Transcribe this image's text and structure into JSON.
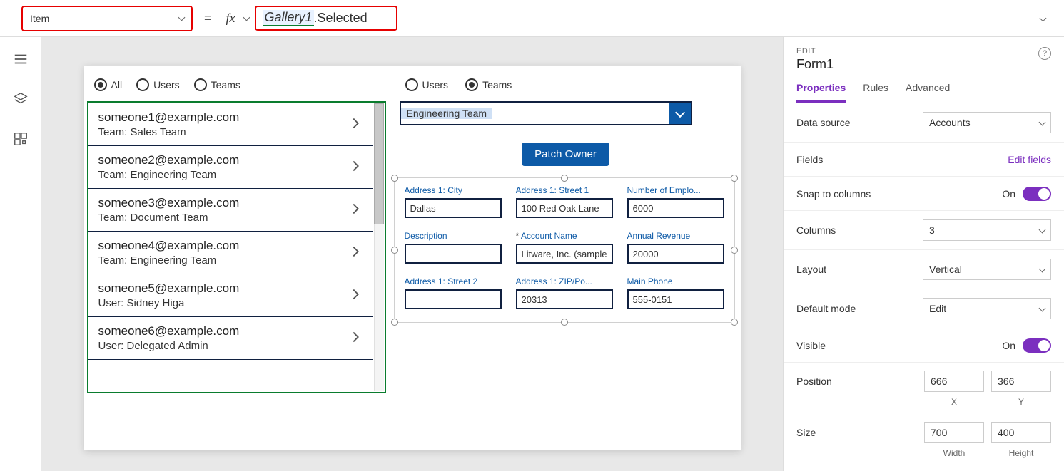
{
  "formula_bar": {
    "property": "Item",
    "fx_label": "fx",
    "var_name": "Gallery1",
    "suffix": ".Selected",
    "equals": "="
  },
  "canvas": {
    "gallery_filter": {
      "options": [
        "All",
        "Users",
        "Teams"
      ],
      "selected": "All"
    },
    "gallery_items": [
      {
        "title": "someone1@example.com",
        "sub": "Team: Sales Team"
      },
      {
        "title": "someone2@example.com",
        "sub": "Team: Engineering Team"
      },
      {
        "title": "someone3@example.com",
        "sub": "Team: Document Team"
      },
      {
        "title": "someone4@example.com",
        "sub": "Team: Engineering Team"
      },
      {
        "title": "someone5@example.com",
        "sub": "User: Sidney Higa"
      },
      {
        "title": "someone6@example.com",
        "sub": "User: Delegated Admin"
      }
    ],
    "form_filter": {
      "options": [
        "Users",
        "Teams"
      ],
      "selected": "Teams"
    },
    "team_dropdown": "Engineering Team",
    "patch_button": "Patch Owner",
    "form_fields": {
      "city": {
        "label": "Address 1: City",
        "value": "Dallas"
      },
      "street1": {
        "label": "Address 1: Street 1",
        "value": "100 Red Oak Lane"
      },
      "employees": {
        "label": "Number of Emplo...",
        "value": "6000"
      },
      "description": {
        "label": "Description",
        "value": ""
      },
      "account_name": {
        "label": "Account Name",
        "value": "Litware, Inc. (sample)",
        "required": true
      },
      "revenue": {
        "label": "Annual Revenue",
        "value": "20000"
      },
      "street2": {
        "label": "Address 1: Street 2",
        "value": ""
      },
      "zip": {
        "label": "Address 1: ZIP/Po...",
        "value": "20313"
      },
      "phone": {
        "label": "Main Phone",
        "value": "555-0151"
      }
    }
  },
  "panel": {
    "edit_label": "EDIT",
    "control_name": "Form1",
    "tabs": {
      "properties": "Properties",
      "rules": "Rules",
      "advanced": "Advanced"
    },
    "data_source": {
      "label": "Data source",
      "value": "Accounts"
    },
    "fields": {
      "label": "Fields",
      "action": "Edit fields"
    },
    "snap": {
      "label": "Snap to columns",
      "value": "On"
    },
    "columns": {
      "label": "Columns",
      "value": "3"
    },
    "layout": {
      "label": "Layout",
      "value": "Vertical"
    },
    "default_mode": {
      "label": "Default mode",
      "value": "Edit"
    },
    "visible": {
      "label": "Visible",
      "value": "On"
    },
    "position": {
      "label": "Position",
      "x": "666",
      "y": "366",
      "xl": "X",
      "yl": "Y"
    },
    "size": {
      "label": "Size",
      "w": "700",
      "h": "400",
      "wl": "Width",
      "hl": "Height"
    }
  }
}
